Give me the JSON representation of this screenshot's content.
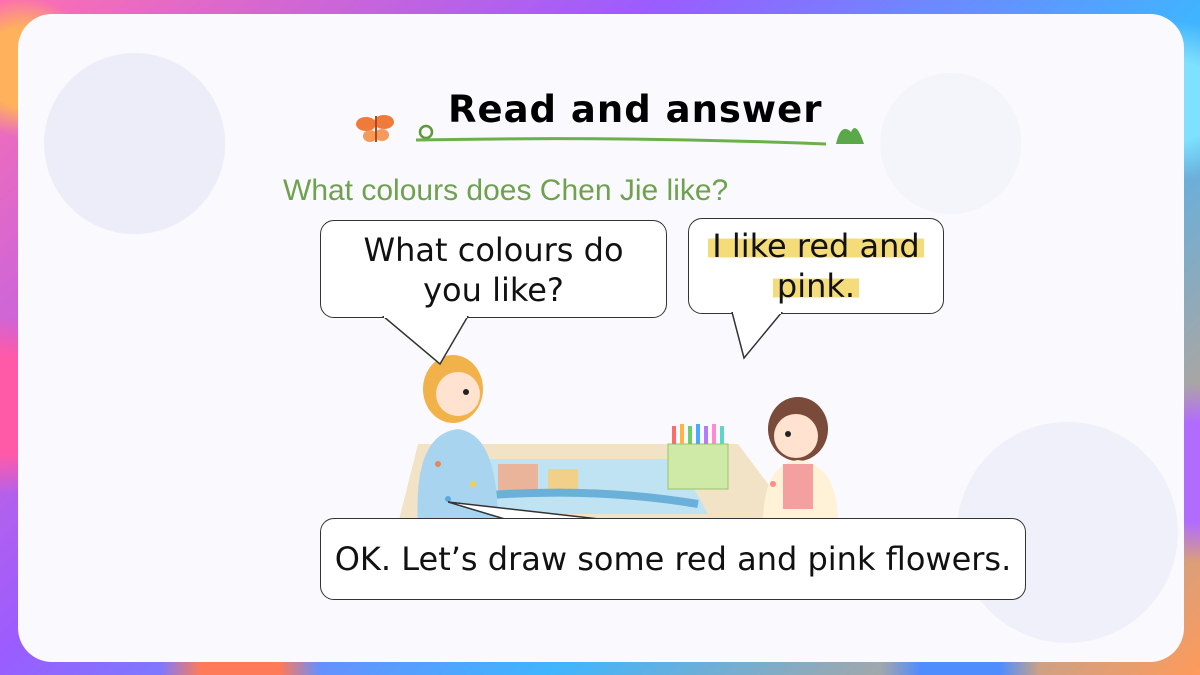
{
  "header": {
    "title": "Read and answer"
  },
  "question": "What colours does Chen Jie like?",
  "dialogue": {
    "bubble1_line1": "What colours do",
    "bubble1_line2": "you like?",
    "bubble2_line1": "I like red and",
    "bubble2_line2": "pink.",
    "bubble3": "OK. Let’s draw some red and pink flowers."
  },
  "colors": {
    "title": "#000000",
    "question": "#6fa14e",
    "highlight": "#f4dc7a"
  }
}
